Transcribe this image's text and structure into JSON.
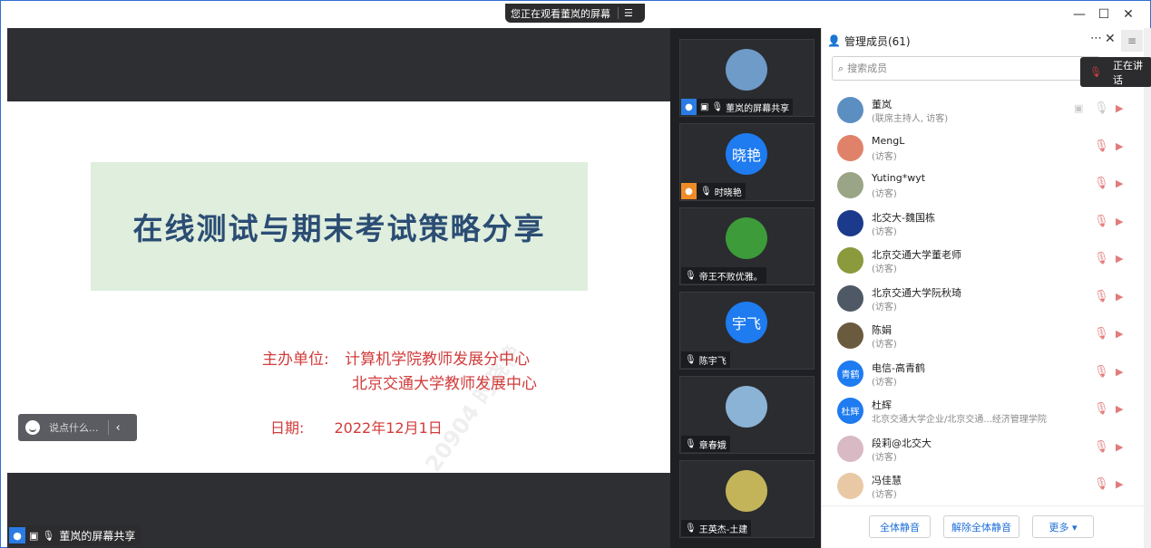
{
  "titlebar": {
    "banner_text": "您正在观看董岚的屏幕",
    "banner_icon": "list-icon",
    "minimize": "—",
    "maximize": "☐",
    "close": "✕"
  },
  "slide": {
    "title": "在线测试与期末考试策略分享",
    "organizer_label": "主办单位:",
    "organizer_1": "计算机学院教师发展分中心",
    "organizer_2": "北京交通大学教师发展中心",
    "date_label": "日期:",
    "date_value": "2022年12月1日",
    "watermark": "20904 时晓艳"
  },
  "chat": {
    "placeholder": "说点什么..."
  },
  "stage_label": "董岚的屏幕共享",
  "tiles": [
    {
      "name": "董岚的屏幕共享",
      "avatar_text": "",
      "avatar_color": "#6e9bc7"
    },
    {
      "name": "时晓艳",
      "avatar_text": "晓艳",
      "avatar_color": "#1e7bf0"
    },
    {
      "name": "帝王不败优雅。",
      "avatar_text": "",
      "avatar_color": "#3d9b3a"
    },
    {
      "name": "陈宇飞",
      "avatar_text": "宇飞",
      "avatar_color": "#1e7bf0"
    },
    {
      "name": "章春娥",
      "avatar_text": "",
      "avatar_color": "#8bb3d6"
    },
    {
      "name": "王英杰-土建",
      "avatar_text": "",
      "avatar_color": "#c3b45a"
    }
  ],
  "panel": {
    "title": "管理成员(61)",
    "more": "⋯",
    "close": "✕",
    "menu": "≡",
    "search_placeholder": "搜索成员",
    "tooltip": "正在讲话"
  },
  "members": [
    {
      "name": "董岚",
      "role": "(联席主持人, 访客)",
      "avatar_text": "",
      "color": "#5b8fc2",
      "muted": false
    },
    {
      "name": "MengL",
      "role": "(访客)",
      "avatar_text": "",
      "color": "#e0826a",
      "muted": true
    },
    {
      "name": "Yuting*wyt",
      "role": "(访客)",
      "avatar_text": "",
      "color": "#9aa486",
      "muted": true
    },
    {
      "name": "北交大-魏国栋",
      "role": "(访客)",
      "avatar_text": "",
      "color": "#1b3a8c",
      "muted": true
    },
    {
      "name": "北京交通大学董老师",
      "role": "(访客)",
      "avatar_text": "",
      "color": "#8a9a3c",
      "muted": true
    },
    {
      "name": "北京交通大学阮秋琦",
      "role": "(访客)",
      "avatar_text": "",
      "color": "#4f5966",
      "muted": true
    },
    {
      "name": "陈娟",
      "role": "(访客)",
      "avatar_text": "",
      "color": "#6a5a3e",
      "muted": true
    },
    {
      "name": "电信-高青鹤",
      "role": "(访客)",
      "avatar_text": "青鹤",
      "color": "#1e7bf0",
      "muted": true
    },
    {
      "name": "杜辉",
      "role": "北京交通大学企业/北京交通...经济管理学院",
      "avatar_text": "杜辉",
      "color": "#1e7bf0",
      "muted": true
    },
    {
      "name": "段莉@北交大",
      "role": "(访客)",
      "avatar_text": "",
      "color": "#d9b9c4",
      "muted": true
    },
    {
      "name": "冯佳慧",
      "role": "(访客)",
      "avatar_text": "",
      "color": "#e9c9a5",
      "muted": true
    }
  ],
  "footer": {
    "mute_all": "全体静音",
    "unmute_all": "解除全体静音",
    "more": "更多 ▾"
  }
}
